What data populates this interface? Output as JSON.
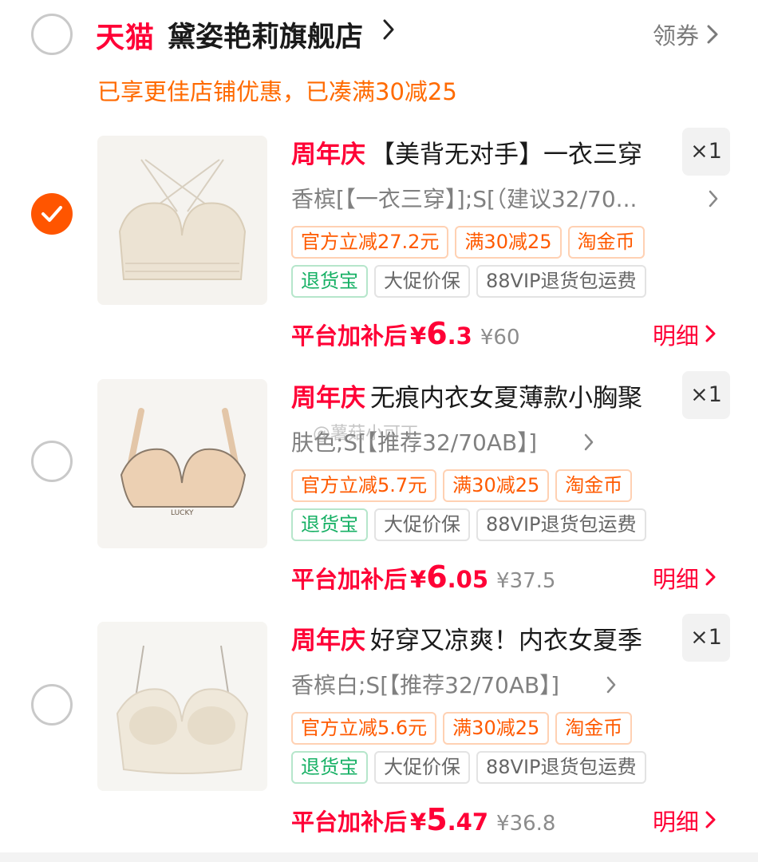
{
  "store": {
    "brand": "天猫",
    "name": "黛姿艳莉旗舰店",
    "coupon_label": "领券",
    "promo_text": "已享更佳店铺优惠，已凑满30减25",
    "selected": false
  },
  "items": [
    {
      "selected": true,
      "tag": "周年庆",
      "title": "【美背无对手】一衣三穿",
      "qty": "×1",
      "sku": "香槟[【一衣三穿】];S[（建议32/70...",
      "badges": [
        {
          "text": "官方立减27.2元",
          "style": "orange"
        },
        {
          "text": "满30减25",
          "style": "orange"
        },
        {
          "text": "淘金币",
          "style": "orange"
        },
        {
          "text": "退货宝",
          "style": "green"
        },
        {
          "text": "大促价保",
          "style": "gray"
        },
        {
          "text": "88VIP退货包运费",
          "style": "gray"
        }
      ],
      "price_label": "平台加补后",
      "price_currency": "¥",
      "price_int": "6",
      "price_dec": ".3",
      "orig_price": "¥60",
      "detail_label": "明细",
      "image": "cream-crossback-bra"
    },
    {
      "selected": false,
      "tag": "周年庆",
      "title": "无痕内衣女夏薄款小胸聚",
      "qty": "×1",
      "sku": "肤色;S[【推荐32/70AB】]",
      "badges": [
        {
          "text": "官方立减5.7元",
          "style": "orange"
        },
        {
          "text": "满30减25",
          "style": "orange"
        },
        {
          "text": "淘金币",
          "style": "orange"
        },
        {
          "text": "退货宝",
          "style": "green"
        },
        {
          "text": "大促价保",
          "style": "gray"
        },
        {
          "text": "88VIP退货包运费",
          "style": "gray"
        }
      ],
      "price_label": "平台加补后",
      "price_currency": "¥",
      "price_int": "6",
      "price_dec": ".05",
      "orig_price": "¥37.5",
      "detail_label": "明细",
      "image": "nude-lucky-bra",
      "image_text": "LUCKY"
    },
    {
      "selected": false,
      "tag": "周年庆",
      "title": "好穿又凉爽！内衣女夏季",
      "qty": "×1",
      "sku": "香槟白;S[【推荐32/70AB】]",
      "badges": [
        {
          "text": "官方立减5.6元",
          "style": "orange"
        },
        {
          "text": "满30减25",
          "style": "orange"
        },
        {
          "text": "淘金币",
          "style": "orange"
        },
        {
          "text": "退货宝",
          "style": "green"
        },
        {
          "text": "大促价保",
          "style": "gray"
        },
        {
          "text": "88VIP退货包运费",
          "style": "gray"
        }
      ],
      "price_label": "平台加补后",
      "price_currency": "¥",
      "price_int": "5",
      "price_dec": ".47",
      "orig_price": "¥36.8",
      "detail_label": "明细",
      "image": "champagne-lace-bra"
    }
  ],
  "watermark": "@薯菇小可丁",
  "colors": {
    "accent_red": "#ff0036",
    "accent_orange": "#ff5500",
    "promo_orange": "#ff6a00",
    "badge_green": "#16b064"
  }
}
